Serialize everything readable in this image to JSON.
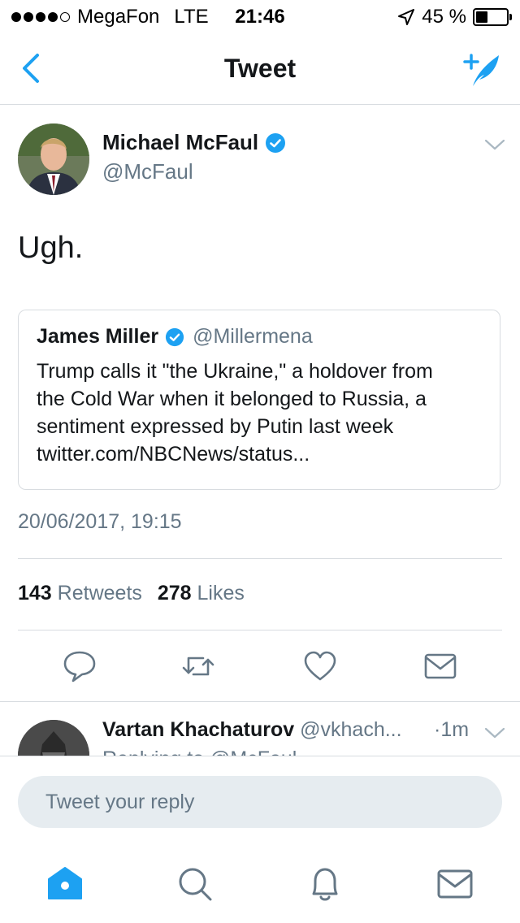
{
  "status_bar": {
    "carrier": "MegaFon",
    "network": "LTE",
    "time": "21:46",
    "battery": "45 %",
    "battery_level": 0.45
  },
  "nav": {
    "title": "Tweet",
    "back_icon": "chevron-left-icon",
    "compose_icon": "compose-tweet-icon"
  },
  "tweet": {
    "author_name": "Michael McFaul",
    "author_handle": "@McFaul",
    "text": "Ugh.",
    "quoted": {
      "name": "James Miller",
      "handle": "@Millermena",
      "lines": [
        "Trump calls it \"the Ukraine,\" a holdover from",
        "the Cold War when it belonged to Russia, a",
        "sentiment expressed by Putin last week",
        "twitter.com/NBCNews/status..."
      ]
    },
    "timestamp": "20/06/2017, 19:15",
    "retweets_count": "143",
    "retweets_label": "Retweets",
    "likes_count": "278",
    "likes_label": "Likes"
  },
  "actions": [
    "reply-icon",
    "retweet-icon",
    "like-icon",
    "direct-message-icon"
  ],
  "reply_preview": {
    "name": "Vartan Khachaturov",
    "handle": "@vkhach...",
    "time": "·1m",
    "sub": "Replying to @McFaul"
  },
  "reply_input": {
    "placeholder": "Tweet your reply"
  },
  "tab_bar": [
    "home-icon",
    "search-icon",
    "notifications-icon",
    "messages-icon"
  ],
  "colors": {
    "accent": "#1da1f2",
    "text_secondary": "#657786",
    "divider": "#d8dce0",
    "input_bg": "#e6ecf0"
  }
}
